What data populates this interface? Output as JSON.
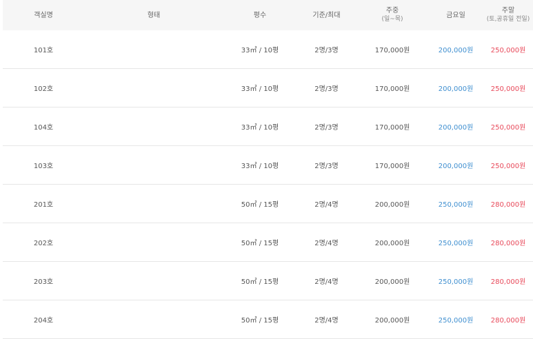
{
  "table": {
    "headers": {
      "name": "객실명",
      "type": "형태",
      "area": "평수",
      "capacity": "기준/최대",
      "weekday": "주중",
      "weekday_sub": "(일~목)",
      "friday": "금요일",
      "weekend": "주말",
      "weekend_sub": "(토,공휴일 전일)"
    },
    "rows": [
      {
        "name": "101호",
        "type": "",
        "area": "33㎡ / 10평",
        "capacity": "2명/3명",
        "weekday": "170,000원",
        "friday": "200,000원",
        "weekend": "250,000원"
      },
      {
        "name": "102호",
        "type": "",
        "area": "33㎡ / 10평",
        "capacity": "2명/3명",
        "weekday": "170,000원",
        "friday": "200,000원",
        "weekend": "250,000원"
      },
      {
        "name": "104호",
        "type": "",
        "area": "33㎡ / 10평",
        "capacity": "2명/3명",
        "weekday": "170,000원",
        "friday": "200,000원",
        "weekend": "250,000원"
      },
      {
        "name": "103호",
        "type": "",
        "area": "33㎡ / 10평",
        "capacity": "2명/3명",
        "weekday": "170,000원",
        "friday": "200,000원",
        "weekend": "250,000원"
      },
      {
        "name": "201호",
        "type": "",
        "area": "50㎡ / 15평",
        "capacity": "2명/4명",
        "weekday": "200,000원",
        "friday": "250,000원",
        "weekend": "280,000원"
      },
      {
        "name": "202호",
        "type": "",
        "area": "50㎡ / 15평",
        "capacity": "2명/4명",
        "weekday": "200,000원",
        "friday": "250,000원",
        "weekend": "280,000원"
      },
      {
        "name": "203호",
        "type": "",
        "area": "50㎡ / 15평",
        "capacity": "2명/4명",
        "weekday": "200,000원",
        "friday": "250,000원",
        "weekend": "280,000원"
      },
      {
        "name": "204호",
        "type": "",
        "area": "50㎡ / 15평",
        "capacity": "2명/4명",
        "weekday": "200,000원",
        "friday": "250,000원",
        "weekend": "280,000원"
      }
    ]
  },
  "colors": {
    "friday_price": "#3f8fd0",
    "weekend_price": "#e8495a",
    "header_background": "#f6f6f6"
  }
}
